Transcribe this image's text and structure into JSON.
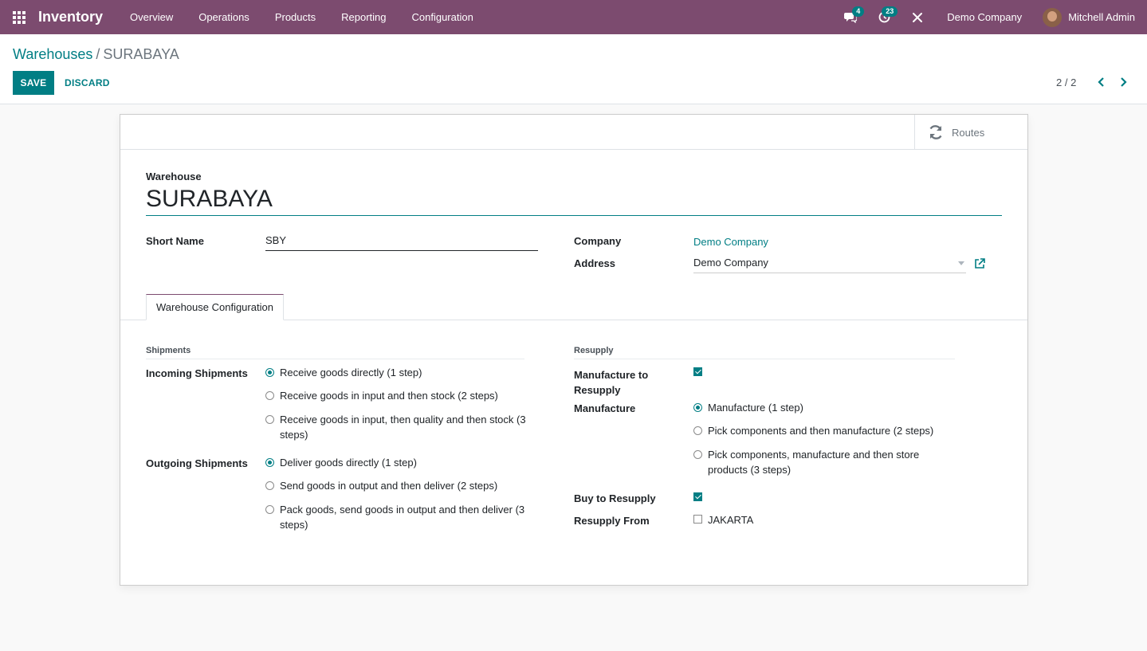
{
  "navbar": {
    "app_name": "Inventory",
    "menu": [
      "Overview",
      "Operations",
      "Products",
      "Reporting",
      "Configuration"
    ],
    "messages_count": "4",
    "activities_count": "23",
    "company": "Demo Company",
    "user": "Mitchell Admin"
  },
  "breadcrumb": {
    "parent": "Warehouses",
    "separator": "/",
    "current": "SURABAYA"
  },
  "actions": {
    "save": "SAVE",
    "discard": "DISCARD"
  },
  "pager": "2 / 2",
  "button_box": {
    "routes": "Routes"
  },
  "form": {
    "title_label": "Warehouse",
    "title_value": "SURABAYA",
    "short_name_label": "Short Name",
    "short_name_value": "SBY",
    "company_label": "Company",
    "company_value": "Demo Company",
    "address_label": "Address",
    "address_value": "Demo Company"
  },
  "tab": "Warehouse Configuration",
  "shipments": {
    "title": "Shipments",
    "incoming_label": "Incoming Shipments",
    "incoming_options": [
      "Receive goods directly (1 step)",
      "Receive goods in input and then stock (2 steps)",
      "Receive goods in input, then quality and then stock (3 steps)"
    ],
    "incoming_selected": 0,
    "outgoing_label": "Outgoing Shipments",
    "outgoing_options": [
      "Deliver goods directly (1 step)",
      "Send goods in output and then deliver (2 steps)",
      "Pack goods, send goods in output and then deliver (3 steps)"
    ],
    "outgoing_selected": 0
  },
  "resupply": {
    "title": "Resupply",
    "manufacture_to_resupply_label": "Manufacture to Resupply",
    "manufacture_to_resupply": true,
    "manufacture_label": "Manufacture",
    "manufacture_options": [
      "Manufacture (1 step)",
      "Pick components and then manufacture (2 steps)",
      "Pick components, manufacture and then store products (3 steps)"
    ],
    "manufacture_selected": 0,
    "buy_label": "Buy to Resupply",
    "buy_to_resupply": true,
    "resupply_from_label": "Resupply From",
    "resupply_from_option": "JAKARTA",
    "resupply_from_checked": false
  },
  "colors": {
    "navbar": "#7c4b6f",
    "accent": "#017e84"
  }
}
